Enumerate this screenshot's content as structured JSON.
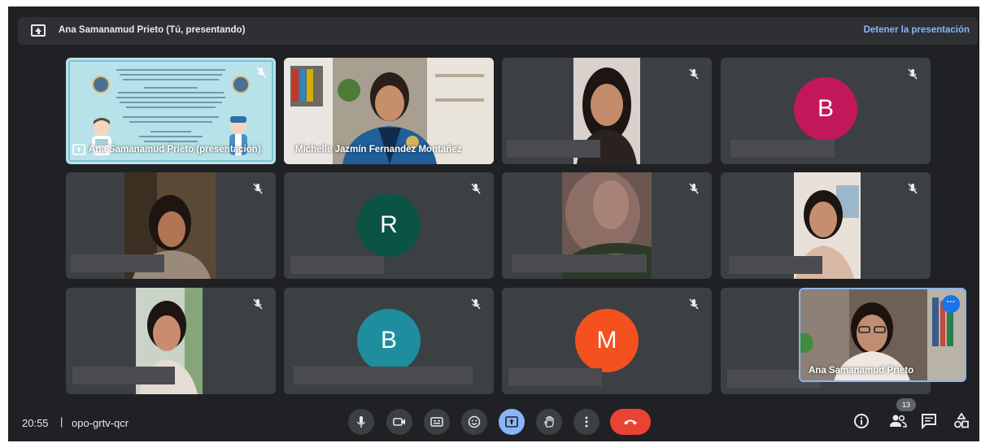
{
  "banner": {
    "title": "Ana Samanamud Prieto (Tú, presentando)",
    "stop_label": "Detener la presentación"
  },
  "tiles": {
    "presentation_name": "Ana Samanamud Prieto (presentación)",
    "video1_name": "Michelle Jazmín Fernandez Montañez",
    "avatar_b1": "B",
    "avatar_r": "R",
    "avatar_b2": "B",
    "avatar_m": "M"
  },
  "self_view": {
    "name": "Ana Samanamud Prieto",
    "more_label": "···"
  },
  "bottom": {
    "time": "20:55",
    "separator": "|",
    "meeting_code": "opo-grtv-qcr",
    "participant_count": "13"
  },
  "colors": {
    "avatar_b1": "#c2185b",
    "avatar_r": "#0b5345",
    "avatar_b2": "#1e8e9e",
    "avatar_m": "#f4511e",
    "leave": "#ea4335",
    "accent": "#8ab4f8"
  },
  "icons": {
    "banner": "present-to-all-icon",
    "mute": "mic-off-icon",
    "controls": [
      "mic-icon",
      "camera-icon",
      "captions-icon",
      "emoji-icon",
      "present-icon",
      "raise-hand-icon",
      "more-options-icon",
      "leave-call-icon"
    ],
    "right": [
      "info-icon",
      "people-icon",
      "chat-icon",
      "activities-icon"
    ]
  }
}
